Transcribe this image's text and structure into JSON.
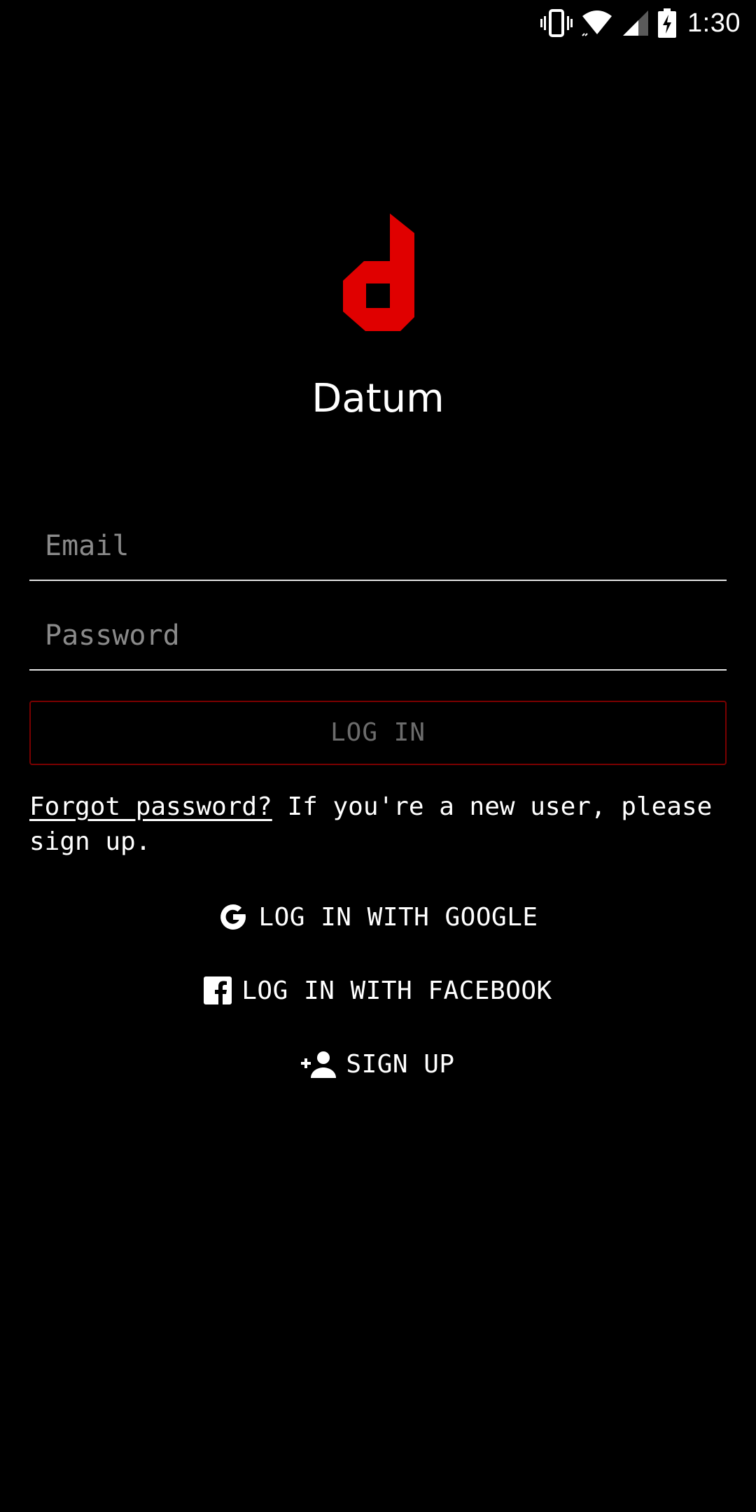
{
  "status_bar": {
    "time": "1:30",
    "icons": [
      "vibrate-icon",
      "wifi-icon",
      "cell-signal-icon",
      "battery-charging-icon"
    ]
  },
  "app": {
    "name": "Datum",
    "brand_color": "#e00000"
  },
  "form": {
    "email_placeholder": "Email",
    "password_placeholder": "Password",
    "login_label": "LOG IN"
  },
  "help": {
    "forgot_label": "Forgot password?",
    "text": " If you're a new user, please sign up."
  },
  "social": {
    "google_label": "LOG IN WITH GOOGLE",
    "google_icon": "google-icon",
    "facebook_label": "LOG IN WITH FACEBOOK",
    "facebook_icon": "facebook-icon",
    "signup_label": "SIGN UP",
    "signup_icon": "add-person-icon"
  }
}
